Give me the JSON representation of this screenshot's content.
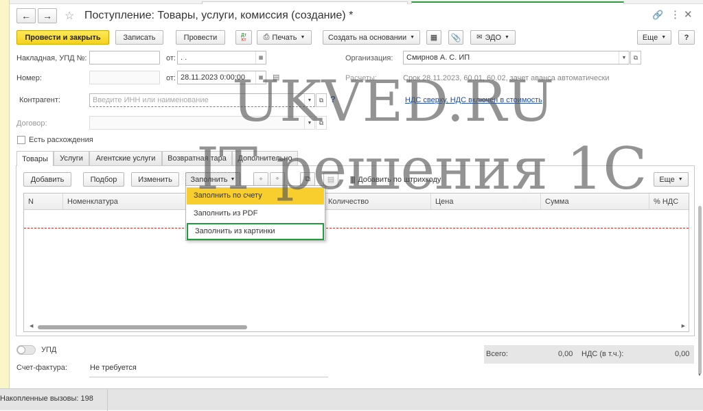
{
  "window": {
    "title": "Поступление: Товары, услуги, комиссия (создание) *"
  },
  "toolbar": {
    "post_and_close": "Провести и закрыть",
    "save": "Записать",
    "post": "Провести",
    "dt_kt_top": "Дт",
    "dt_kt_bottom": "Кт",
    "print": "Печать",
    "create_based_on": "Создать на основании",
    "edo": "ЭДО",
    "more": "Еще",
    "help": "?"
  },
  "header": {
    "invoice_label": "Накладная, УПД №:",
    "invoice_number": "",
    "from_label": "от:",
    "invoice_date": ". .",
    "number_label": "Номер:",
    "number_value": "",
    "doc_date": "28.11.2023  0:00:00",
    "org_label": "Организация:",
    "org_value": "Смирнов А. С. ИП",
    "settlements_label": "Расчеты:",
    "settlements_value": "Срок 28.11.2023, 60.01, 60.02, зачет аванса автоматически",
    "contractor_label": "Контрагент:",
    "contractor_placeholder": "Введите ИНН или наименование",
    "vat_link": "НДС сверху, НДС включен в стоимость",
    "contract_label": "Договор:",
    "discrepancy_label": "Есть расхождения"
  },
  "tabs": [
    {
      "label": "Товары"
    },
    {
      "label": "Услуги"
    },
    {
      "label": "Агентские услуги"
    },
    {
      "label": "Возвратная тара"
    },
    {
      "label": "Дополнительно"
    }
  ],
  "table_toolbar": {
    "add": "Добавить",
    "pick": "Подбор",
    "change": "Изменить",
    "fill": "Заполнить",
    "barcode": "Добавить по штрихкоду",
    "more": "Еще"
  },
  "fill_menu": {
    "items": [
      {
        "label": "Заполнить по счету"
      },
      {
        "label": "Заполнить из PDF"
      },
      {
        "label": "Заполнить из картинки"
      }
    ]
  },
  "table": {
    "columns": [
      "N",
      "Номенклатура",
      "Количество",
      "Цена",
      "Сумма",
      "% НДС"
    ]
  },
  "footer": {
    "upd_label": "УПД",
    "invoice_label": "Счет-фактура:",
    "invoice_value": "Не требуется",
    "total_label": "Всего:",
    "total_value": "0,00",
    "vat_label": "НДС (в т.ч.):",
    "vat_value": "0,00"
  },
  "status": {
    "accumulated_calls": "Накопленные вызовы: 198"
  },
  "watermark": {
    "line1": "UKVED.RU",
    "line2": "IT решения 1С"
  },
  "colors": {
    "accent_yellow": "#f5d21b",
    "menu_highlight": "#f8ce2f",
    "menu_outline_green": "#1f9d3a",
    "link_blue": "#1f4fa3"
  }
}
